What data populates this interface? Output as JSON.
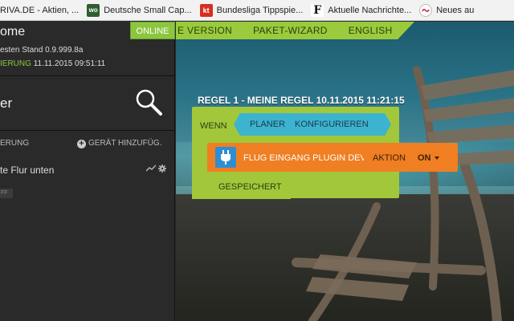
{
  "bookmarks": [
    {
      "label": "RIVA.DE - Aktien, ...",
      "icon": "riva-favicon"
    },
    {
      "label": "Deutsche Small Cap...",
      "icon": "wo-favicon",
      "badge": "wo"
    },
    {
      "label": "Bundesliga Tippspie...",
      "icon": "kt-favicon",
      "badge": "kt"
    },
    {
      "label": "Aktuelle Nachrichte...",
      "icon": "faz-favicon",
      "badge": "F"
    },
    {
      "label": "Neues au",
      "icon": "news-favicon"
    }
  ],
  "sidebar": {
    "title": "ome",
    "version": "esten Stand 0.9.999.8a",
    "sync_label": "IERUNG",
    "sync_time": "11.11.2015 09:51:11",
    "search_text": "er",
    "row_left": "ERUNG",
    "add_device": "GERÄT HINZUFÜG.",
    "device_name": "te Flur unten",
    "toggle": "FF"
  },
  "status": "ONLINE",
  "nav": {
    "items": [
      "E VERSION",
      "PAKET-WIZARD",
      "ENGLISH"
    ]
  },
  "rule": {
    "title": "REGEL 1 - MEINE REGEL 10.11.2015 11:21:15",
    "when_label": "WENN",
    "planner_label": "PLANER",
    "planner_action": "KONFIGURIEREN",
    "action_name": "FLUG EINGANG PLUGIN DEVICE",
    "action_label": "AKTION",
    "action_value": "ON",
    "saved_label": "GESPEICHERT"
  },
  "colors": {
    "online_green": "#8cc63f",
    "nav_green": "#9acb3c",
    "block_green": "#a3c73a",
    "planner_blue": "#3cb4cf",
    "action_orange": "#ef7f22",
    "plug_blue": "#2f8ed3"
  }
}
